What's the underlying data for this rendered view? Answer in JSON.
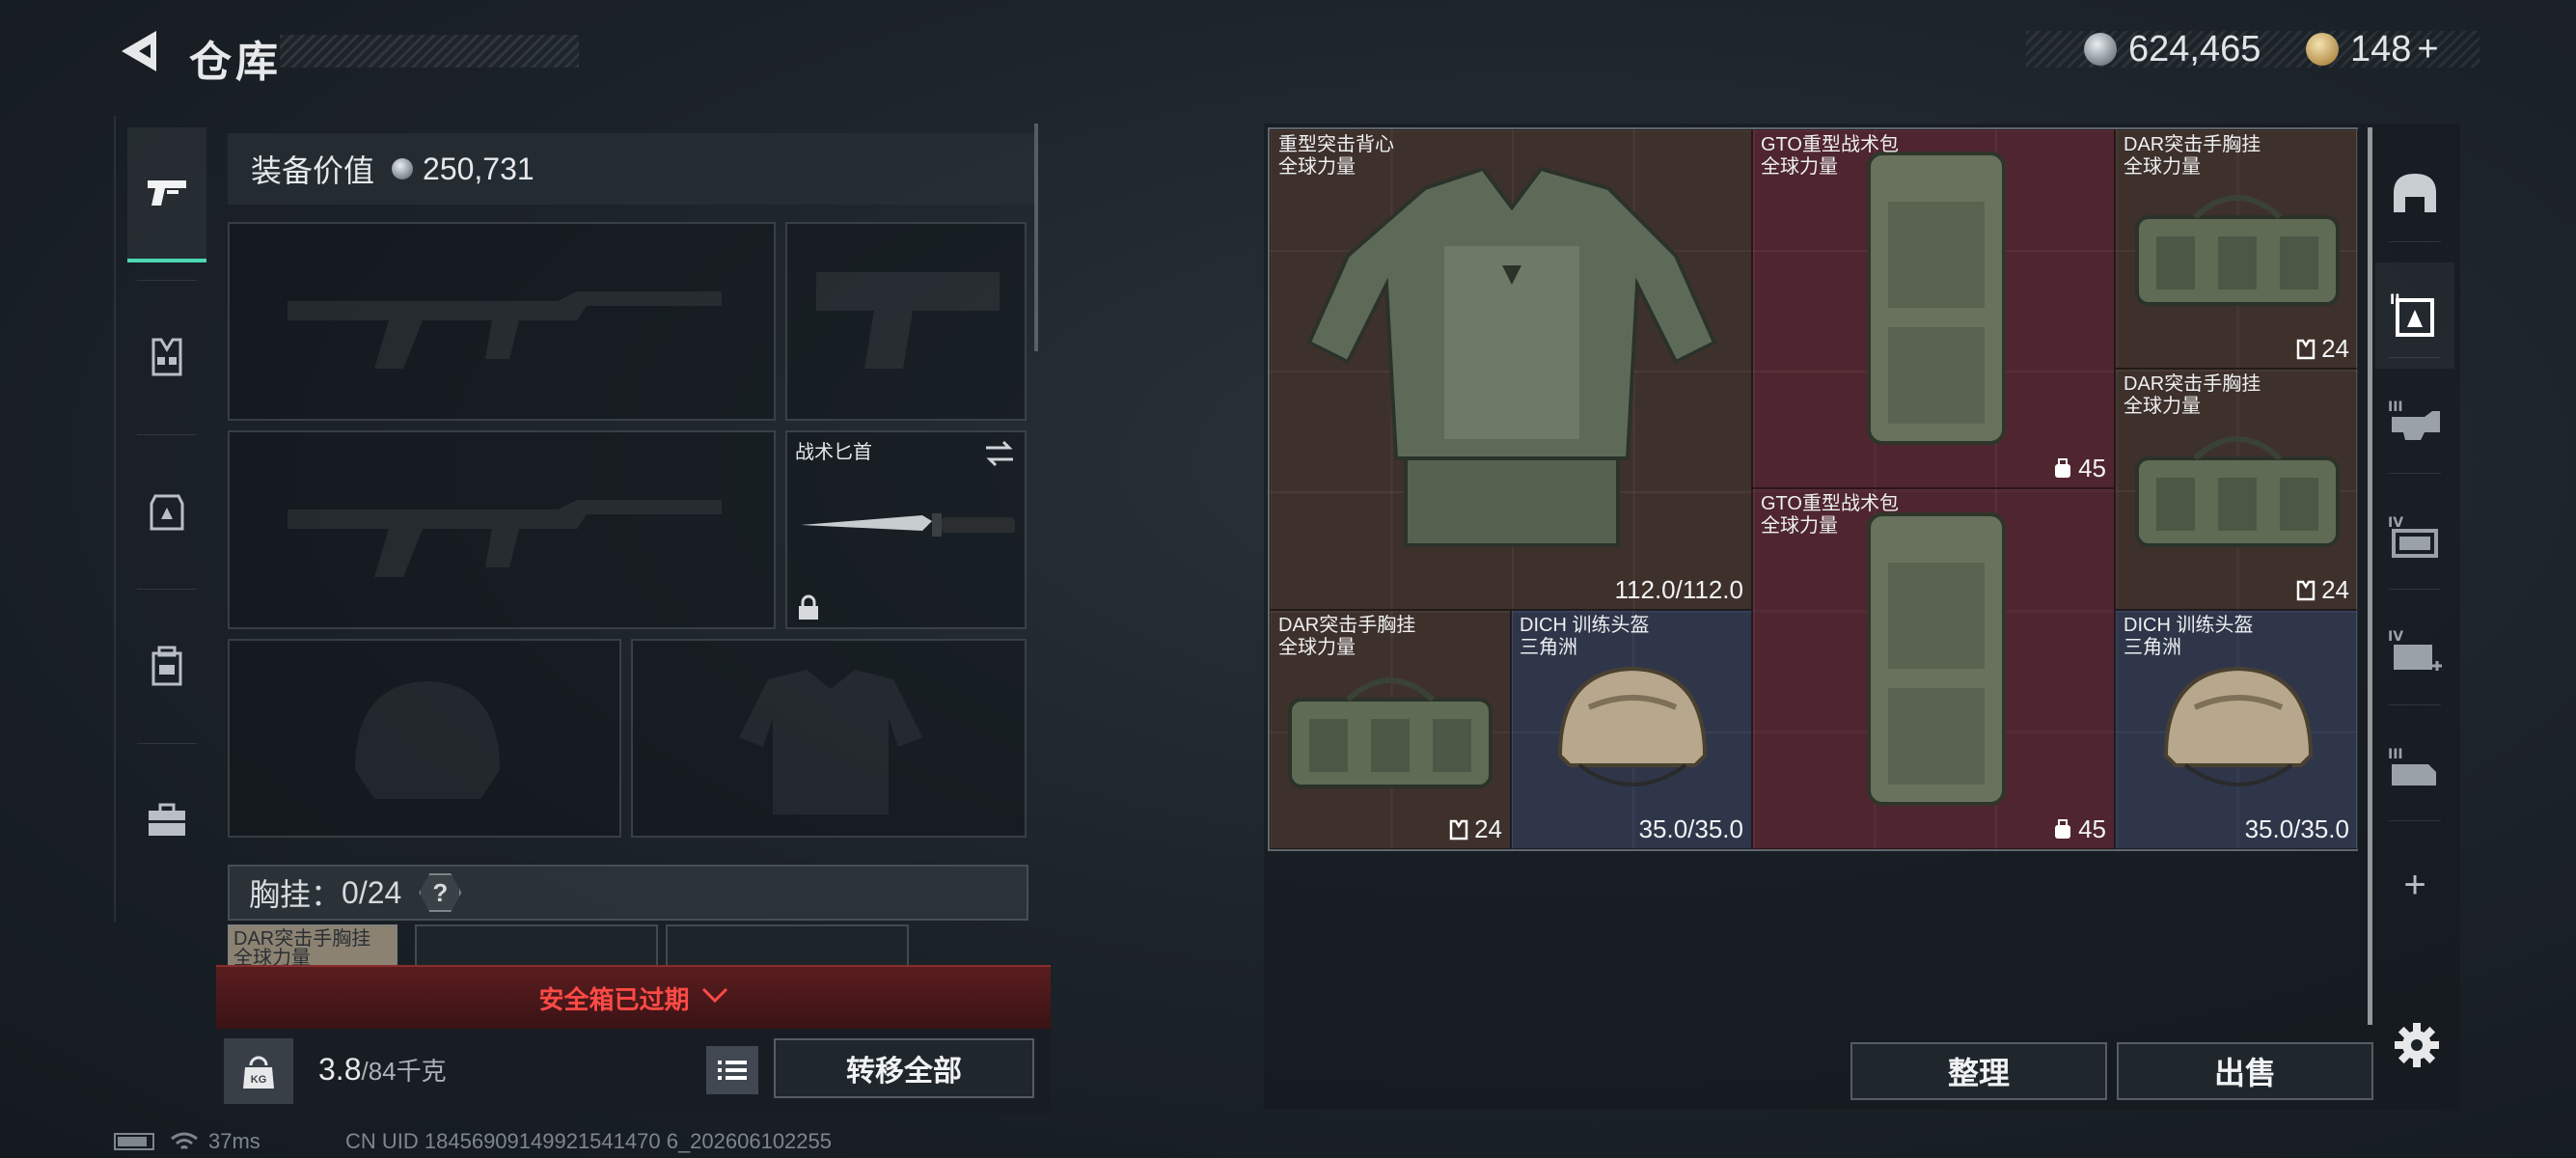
{
  "header": {
    "title": "仓库",
    "currency_silver": "624,465",
    "currency_gold": "148",
    "gold_plus": "+"
  },
  "left_nav": {
    "items": [
      {
        "name": "weapons-tab",
        "icon": "pistol-icon",
        "active": true
      },
      {
        "name": "vest-tab",
        "icon": "chest-rig-icon",
        "active": false
      },
      {
        "name": "armor-tab",
        "icon": "backpack-armor-icon",
        "active": false
      },
      {
        "name": "bag-tab",
        "icon": "bag-icon",
        "active": false
      },
      {
        "name": "case-tab",
        "icon": "briefcase-icon",
        "active": false
      }
    ]
  },
  "equipment": {
    "value_label": "装备价值",
    "value": "250,731",
    "knife_label": "战术匕首",
    "vest_label": "胸挂：",
    "vest_capacity": "0/24",
    "vest_help": "?",
    "vest_item_name": "DAR突击手胸挂",
    "vest_item_sub": "全球力量",
    "safe_box_status": "安全箱已过期",
    "weight_current": "3.8",
    "weight_max": "/84千克",
    "kg_icon_label": "KG",
    "transfer_all": "转移全部"
  },
  "storage": {
    "items": [
      {
        "name": "重型突击背心",
        "sub": "全球力量",
        "stat": "112.0/112.0",
        "color": "brown"
      },
      {
        "name": "GTO重型战术包",
        "sub": "全球力量",
        "stat": "45",
        "color": "red"
      },
      {
        "name": "DAR突击手胸挂",
        "sub": "全球力量",
        "stat": "24",
        "color": "brown"
      },
      {
        "name": "DAR突击手胸挂",
        "sub": "全球力量",
        "stat": "24",
        "color": "brown"
      },
      {
        "name": "GTO重型战术包",
        "sub": "全球力量",
        "stat": "45",
        "color": "red"
      },
      {
        "name": "DAR突击手胸挂",
        "sub": "全球力量",
        "stat": "24",
        "color": "brown"
      },
      {
        "name": "DICH 训练头盔",
        "sub": "三角洲",
        "stat": "35.0/35.0",
        "color": "blue"
      },
      {
        "name": "DICH 训练头盔",
        "sub": "三角洲",
        "stat": "35.0/35.0",
        "color": "blue"
      }
    ],
    "sort_button": "整理",
    "sell_button": "出售"
  },
  "right_nav": {
    "items": [
      "helmet-icon",
      "storage-page-2-icon",
      "storage-page-3-icon",
      "storage-page-4-icon",
      "storage-page-4-add-icon",
      "storage-page-3-locked-icon"
    ],
    "add_label": "+"
  },
  "status_bar": {
    "ping": "37ms",
    "uid": "CN UID 18456909149921541470 6_202606102255"
  },
  "colors": {
    "accent": "#4cd8b0",
    "warning": "#ff4a45",
    "item_brown": "#5a3c2d",
    "item_red": "#782834",
    "item_blue": "#3c4260"
  }
}
